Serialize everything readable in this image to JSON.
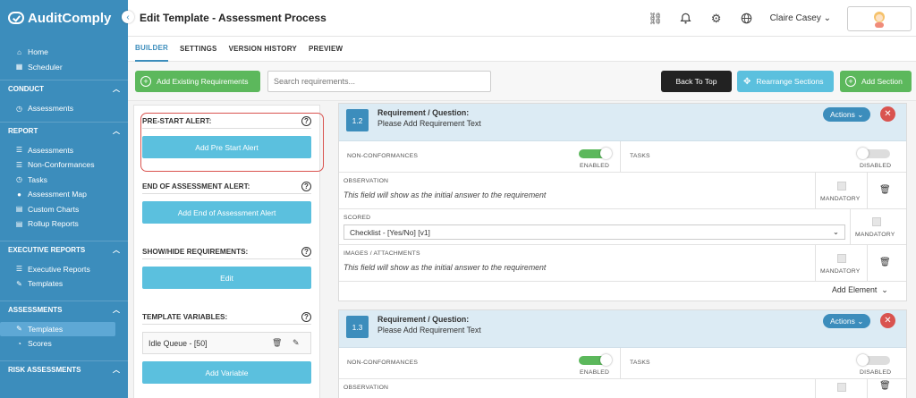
{
  "app": {
    "name": "AuditComply"
  },
  "sidebar": {
    "top_items": [
      {
        "icon": "home-icon",
        "label": "Home"
      },
      {
        "icon": "calendar-icon",
        "label": "Scheduler"
      }
    ],
    "sections": [
      {
        "title": "CONDUCT",
        "items": [
          {
            "icon": "clock-icon",
            "label": "Assessments"
          }
        ]
      },
      {
        "title": "REPORT",
        "items": [
          {
            "icon": "list-icon",
            "label": "Assessments"
          },
          {
            "icon": "list-icon",
            "label": "Non-Conformances"
          },
          {
            "icon": "clock-icon",
            "label": "Tasks"
          },
          {
            "icon": "map-pin-icon",
            "label": "Assessment Map"
          },
          {
            "icon": "chart-icon",
            "label": "Custom Charts"
          },
          {
            "icon": "chart-icon",
            "label": "Rollup Reports"
          }
        ]
      },
      {
        "title": "EXECUTIVE REPORTS",
        "items": [
          {
            "icon": "list-icon",
            "label": "Executive Reports"
          },
          {
            "icon": "edit-icon",
            "label": "Templates"
          }
        ]
      },
      {
        "title": "ASSESSMENTS",
        "items": [
          {
            "icon": "edit-icon",
            "label": "Templates"
          },
          {
            "icon": "gauge-icon",
            "label": "Scores"
          }
        ]
      },
      {
        "title": "RISK ASSESSMENTS",
        "items": []
      }
    ]
  },
  "header": {
    "title": "Edit Template - Assessment Process",
    "user": "Claire Casey"
  },
  "tabs": [
    "BUILDER",
    "SETTINGS",
    "VERSION HISTORY",
    "PREVIEW"
  ],
  "toolbar": {
    "add_existing": "Add Existing Requirements",
    "search_placeholder": "Search requirements...",
    "back_to_top": "Back To Top",
    "rearrange": "Rearrange Sections",
    "add_section": "Add Section"
  },
  "left_panel": {
    "pre_start_label": "PRE-START ALERT:",
    "pre_start_btn": "Add Pre Start Alert",
    "end_label": "END OF ASSESSMENT ALERT:",
    "end_btn": "Add End of Assessment Alert",
    "showhide_label": "SHOW/HIDE REQUIREMENTS:",
    "showhide_btn": "Edit",
    "vars_label": "TEMPLATE VARIABLES:",
    "variable": "Idle Queue - [50]",
    "add_variable_btn": "Add Variable"
  },
  "requirements": [
    {
      "number": "1.2",
      "title": "Requirement / Question:",
      "text": "Please Add Requirement Text",
      "actions": "Actions",
      "nc_label": "NON-CONFORMANCES",
      "nc_state": "ENABLED",
      "tasks_label": "TASKS",
      "tasks_state": "DISABLED",
      "obs_label": "OBSERVATION",
      "obs_text": "This field will show as the initial answer to the requirement",
      "mandatory": "MANDATORY",
      "scored_label": "SCORED",
      "scored_value": "Checklist - [Yes/No] [v1]",
      "img_label": "IMAGES / ATTACHMENTS",
      "img_text": "This field will show as the initial answer to the requirement",
      "add_element": "Add Element"
    },
    {
      "number": "1.3",
      "title": "Requirement / Question:",
      "text": "Please Add Requirement Text",
      "actions": "Actions",
      "nc_label": "NON-CONFORMANCES",
      "nc_state": "ENABLED",
      "tasks_label": "TASKS",
      "tasks_state": "DISABLED",
      "obs_label": "OBSERVATION"
    }
  ],
  "colors": {
    "sidebar": "#3c8dbc",
    "green": "#5cb85c",
    "blue": "#5bc0de",
    "danger": "#d9534f",
    "dark": "#222222"
  }
}
